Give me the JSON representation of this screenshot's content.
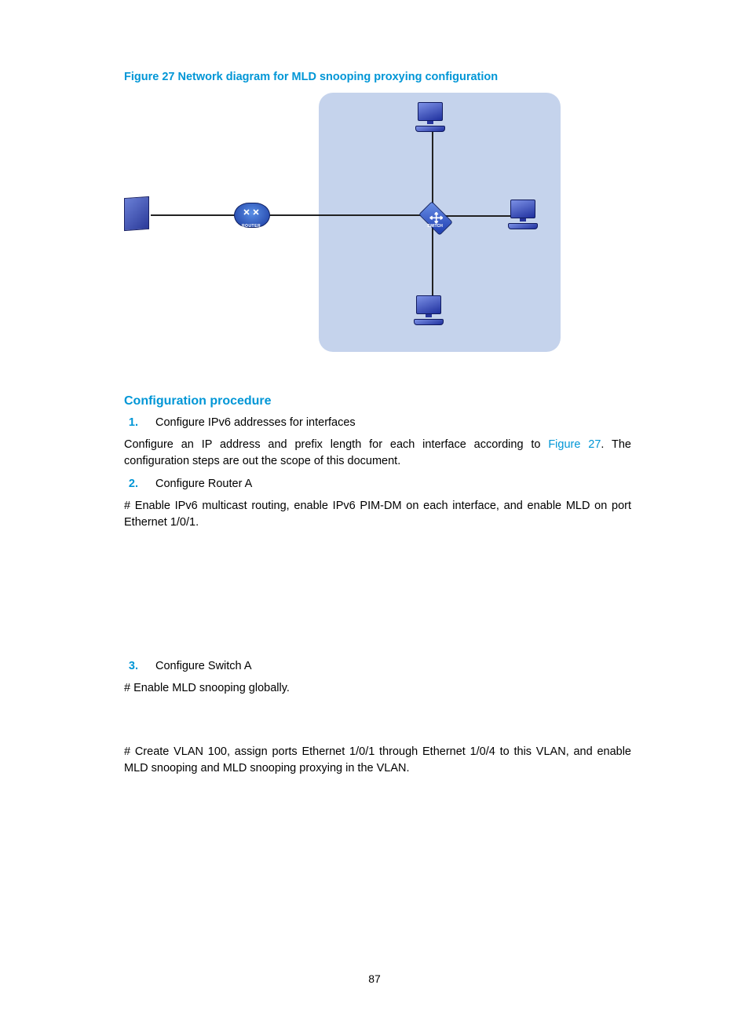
{
  "figure": {
    "caption": "Figure 27 Network diagram for MLD snooping proxying configuration",
    "link_text": "Figure 27"
  },
  "section": {
    "heading": "Configuration procedure"
  },
  "steps": {
    "s1": {
      "num": "1.",
      "label": "Configure IPv6 addresses for interfaces"
    },
    "s2": {
      "num": "2.",
      "label": "Configure Router A"
    },
    "s3": {
      "num": "3.",
      "label": "Configure Switch A"
    }
  },
  "paras": {
    "p1a": "Configure an IP address and prefix length for each interface according to ",
    "p1b": ". The configuration steps are out the scope of this document.",
    "p2": "# Enable IPv6 multicast routing, enable IPv6 PIM-DM on each interface, and enable MLD on port Ethernet 1/0/1.",
    "p3": "# Enable MLD snooping globally.",
    "p4": "# Create VLAN 100, assign ports Ethernet 1/0/1 through Ethernet 1/0/4 to this VLAN, and enable MLD snooping and MLD snooping proxying in the VLAN."
  },
  "labels": {
    "router": "ROUTER",
    "switch": "SWITCH"
  },
  "page_number": "87"
}
